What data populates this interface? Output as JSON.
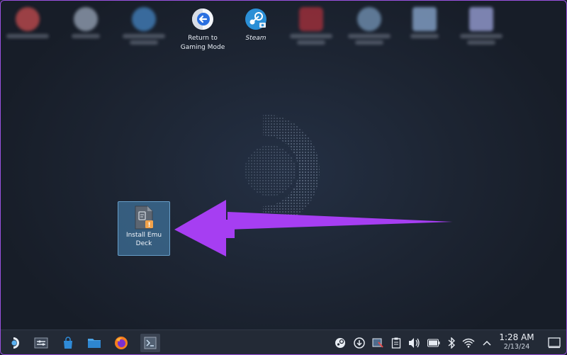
{
  "desktop": {
    "icons": [
      {
        "label": "Return to Gaming Mode",
        "label_line1": "Return to",
        "label_line2": "Gaming Mode",
        "icon": "return-arrow-icon"
      },
      {
        "label": "Steam",
        "icon": "steam-icon"
      }
    ],
    "selected_icon": {
      "label_line1": "Install Emu",
      "label_line2": "Deck",
      "icon": "script-file-warning-icon"
    }
  },
  "taskbar": {
    "items": [
      {
        "name": "application-launcher",
        "icon": "steamdeck-launcher-icon"
      },
      {
        "name": "task-switcher",
        "icon": "sliders-icon"
      },
      {
        "name": "discover-store",
        "icon": "shopping-bag-icon"
      },
      {
        "name": "file-manager",
        "icon": "folder-icon"
      },
      {
        "name": "firefox",
        "icon": "firefox-icon"
      },
      {
        "name": "window-install-emu-deck",
        "icon": "script-window-icon"
      }
    ],
    "tray": [
      "steam-tray-icon",
      "steamdeck-update-icon",
      "screenshot-tool-icon",
      "clipboard-icon",
      "volume-icon",
      "battery-icon",
      "bluetooth-icon",
      "wifi-icon",
      "chevron-up-icon"
    ],
    "clock": {
      "time": "1:28 AM",
      "date": "2/13/24"
    },
    "show_desktop_icon": "show-desktop-icon"
  },
  "colors": {
    "arrow": "#a63ef2",
    "selection": "#4a8cbe",
    "taskbar": "#232a36"
  }
}
